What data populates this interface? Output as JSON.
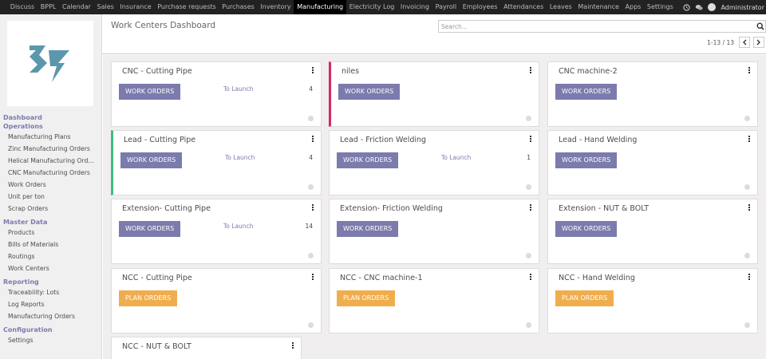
{
  "topbar": {
    "menu": [
      {
        "label": "Discuss"
      },
      {
        "label": "BPPL"
      },
      {
        "label": "Calendar"
      },
      {
        "label": "Sales"
      },
      {
        "label": "Insurance"
      },
      {
        "label": "Purchase requests"
      },
      {
        "label": "Purchases"
      },
      {
        "label": "Inventory"
      },
      {
        "label": "Manufacturing",
        "active": true
      },
      {
        "label": "Electricity Log"
      },
      {
        "label": "Invoicing"
      },
      {
        "label": "Payroll"
      },
      {
        "label": "Employees"
      },
      {
        "label": "Attendances"
      },
      {
        "label": "Leaves"
      },
      {
        "label": "Maintenance"
      },
      {
        "label": "Apps"
      },
      {
        "label": "Settings"
      }
    ],
    "user": "Administrator",
    "icons": [
      "clock-icon",
      "chat-icon"
    ]
  },
  "sidebar": {
    "logo": "company-logo",
    "sections": [
      {
        "title": "Dashboard",
        "items": []
      },
      {
        "title": "Operations",
        "items": [
          "Manufacturing Plans",
          "Zinc Manufacturing Orders",
          "Helical Manufacturing Ord...",
          "CNC Manufacturing Orders",
          "Work Orders",
          "Unit per ton",
          "Scrap Orders"
        ]
      },
      {
        "title": "Master Data",
        "items": [
          "Products",
          "Bills of Materials",
          "Routings",
          "Work Centers"
        ]
      },
      {
        "title": "Reporting",
        "items": [
          "Traceability: Lots",
          "Log Reports",
          "Manufacturing Orders"
        ]
      },
      {
        "title": "Configuration",
        "items": [
          "Settings"
        ]
      }
    ]
  },
  "control": {
    "title": "Work Centers Dashboard",
    "search_placeholder": "Search...",
    "pager": "1-13 / 13"
  },
  "kanban": {
    "cards": [
      {
        "title": "CNC - Cutting Pipe",
        "button": "WORK ORDERS",
        "type": "wo",
        "launch": "To Launch",
        "count": "4"
      },
      {
        "title": "niles",
        "button": "WORK ORDERS",
        "type": "wo",
        "accent": "#d32b62"
      },
      {
        "title": "CNC machine-2",
        "button": "WORK ORDERS",
        "type": "wo"
      },
      {
        "title": "Lead - Cutting Pipe",
        "button": "WORK ORDERS",
        "type": "wo",
        "launch": "To Launch",
        "count": "4",
        "accent": "#3cbe7d"
      },
      {
        "title": "Lead - Friction Welding",
        "button": "WORK ORDERS",
        "type": "wo",
        "launch": "To Launch",
        "count": "1"
      },
      {
        "title": "Lead - Hand Welding",
        "button": "WORK ORDERS",
        "type": "wo"
      },
      {
        "title": "Extension- Cutting Pipe",
        "button": "WORK ORDERS",
        "type": "wo",
        "launch": "To Launch",
        "count": "14"
      },
      {
        "title": "Extension- Friction Welding",
        "button": "WORK ORDERS",
        "type": "wo"
      },
      {
        "title": "Extension - NUT & BOLT",
        "button": "WORK ORDERS",
        "type": "wo"
      },
      {
        "title": "NCC - Cutting Pipe",
        "button": "PLAN ORDERS",
        "type": "po"
      },
      {
        "title": "NCC - CNC machine-1",
        "button": "PLAN ORDERS",
        "type": "po"
      },
      {
        "title": "NCC - Hand Welding",
        "button": "PLAN ORDERS",
        "type": "po"
      },
      {
        "title": "NCC - NUT & BOLT"
      }
    ]
  },
  "colors": {
    "topbar": "#222222",
    "primary": "#7c7bad",
    "plan_button": "#f0ad4e",
    "logo": "#5b97ad"
  }
}
